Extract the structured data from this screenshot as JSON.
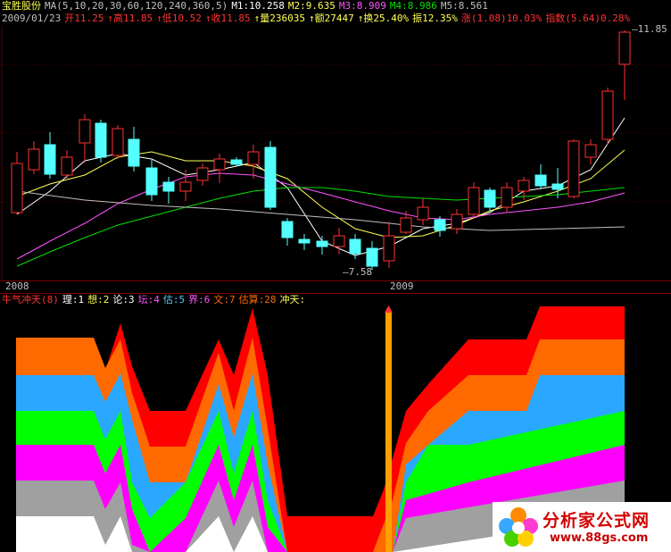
{
  "header": {
    "stock_name": "宝胜股份",
    "ma_params": "MA(5,10,20,30,60,120,240,360,5)",
    "m1": "M1:10.258",
    "m2": "M2:9.635",
    "m3": "M3:8.909",
    "m4": "M4:8.986",
    "m5": "M5:8.561"
  },
  "quote": {
    "date": "2009/01/23",
    "open": "开11.25",
    "high": "↑高11.85",
    "low": "↑低10.52",
    "close": "↑收11.85",
    "volume": "↑量236035",
    "amount": "↑额27447",
    "turnover": "↑换25.40%",
    "amplitude": "振12.35%",
    "change": "涨(1.08)10.03%",
    "index": "指数(5.64)0.28%"
  },
  "price_chart": {
    "max_label": "11.85",
    "min_label": "7.58",
    "x_axis_labels": [
      "2008",
      "2009"
    ]
  },
  "indicator": {
    "name": "牛气冲天(8)",
    "items": [
      "理:1",
      "想:2",
      "论:3",
      "坛:4",
      "估:5",
      "界:6",
      "文:7",
      "估算:28",
      "冲天:"
    ]
  },
  "watermark": {
    "title": "分析家公式网",
    "url": "www.88gs.com"
  },
  "colors": {
    "up": "#ff3232",
    "down": "#54ffff",
    "ma5": "#ffffff",
    "ma10": "#ffff54",
    "ma20": "#ff54ff",
    "ma30": "#00e000",
    "ma60": "#c0c0c0",
    "band1": "#ff0000",
    "band2": "#ff6a00",
    "band3": "#2aa8ff",
    "band4": "#00ff00",
    "band5": "#ff00ff",
    "band6": "#a0a0a0",
    "band7": "#ffffff",
    "spike": "#ffa000"
  }
}
